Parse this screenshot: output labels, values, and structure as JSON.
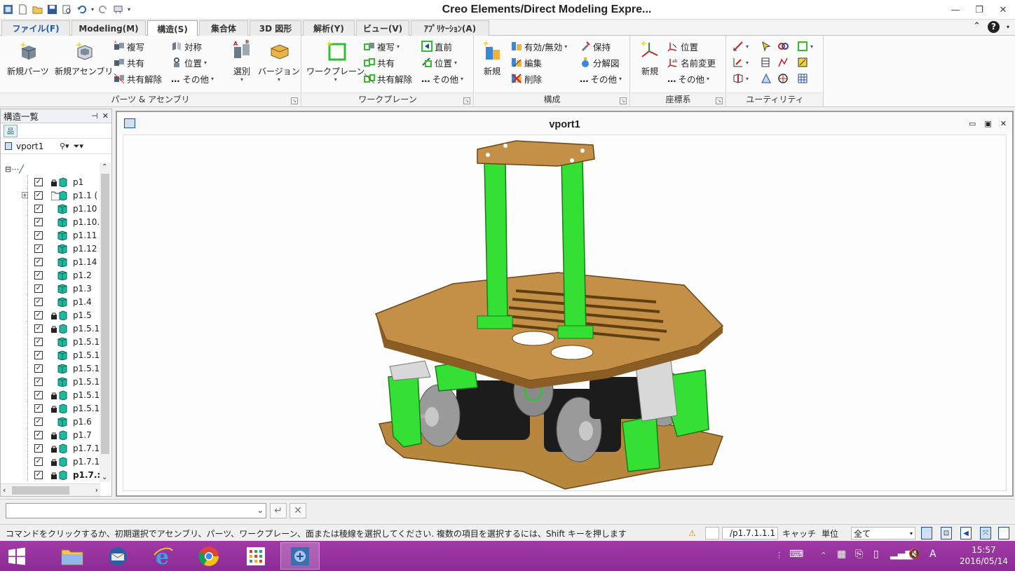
{
  "window": {
    "title": "Creo Elements/Direct Modeling Expre..."
  },
  "quick_access": [
    "app-icon",
    "new-icon",
    "open-icon",
    "save-icon",
    "print-preview-icon",
    "undo-icon",
    "redo-icon",
    "customize-icon"
  ],
  "tabs": [
    {
      "label": "ファイル(F)"
    },
    {
      "label": "Modeling(M)"
    },
    {
      "label": "構造(S)",
      "active": true
    },
    {
      "label": "集合体"
    },
    {
      "label": "3D 図形"
    },
    {
      "label": "解析(Y)"
    },
    {
      "label": "ビュー(V)"
    },
    {
      "label": "ｱﾌﾟﾘｹｰｼｮﾝ(A)"
    }
  ],
  "ribbon": {
    "parts_group": {
      "label": "パーツ & アセンブリ",
      "new_part": "新規パーツ",
      "new_assembly": "新規アセンブリ",
      "copy": "複写",
      "share": "共有",
      "unshare": "共有解除",
      "symmetric": "対称",
      "position": "位置",
      "other": "その他",
      "select": "選別",
      "version": "バージョン"
    },
    "workplane_group": {
      "label": "ワークプレーン",
      "workplane": "ワークプレーン",
      "copy": "複写",
      "share": "共有",
      "unshare": "共有解除",
      "previous": "直前",
      "position": "位置",
      "other": "その他"
    },
    "config_group": {
      "label": "構成",
      "new": "新規",
      "toggle": "有効/無効",
      "edit": "編集",
      "delete": "削除",
      "keep": "保持",
      "explode": "分解図",
      "other": "その他"
    },
    "coord_group": {
      "label": "座標系",
      "new": "新規",
      "position": "位置",
      "rename": "名前変更",
      "other": "その他"
    },
    "utility_group": {
      "label": "ユーティリティ"
    }
  },
  "structure_panel": {
    "title": "構造一覧",
    "viewport_selector": "vport1",
    "items": [
      {
        "name": "p1",
        "type": "assembly"
      },
      {
        "name": "p1.1 (",
        "type": "folder",
        "expandable": true
      },
      {
        "name": "p1.10",
        "type": "part"
      },
      {
        "name": "p1.10.",
        "type": "part"
      },
      {
        "name": "p1.11",
        "type": "part"
      },
      {
        "name": "p1.12",
        "type": "part"
      },
      {
        "name": "p1.14",
        "type": "part"
      },
      {
        "name": "p1.2",
        "type": "part"
      },
      {
        "name": "p1.3",
        "type": "part"
      },
      {
        "name": "p1.4",
        "type": "part"
      },
      {
        "name": "p1.5",
        "type": "assembly"
      },
      {
        "name": "p1.5.1",
        "type": "assembly"
      },
      {
        "name": "p1.5.1",
        "type": "part"
      },
      {
        "name": "p1.5.1",
        "type": "part"
      },
      {
        "name": "p1.5.1",
        "type": "part"
      },
      {
        "name": "p1.5.1",
        "type": "part"
      },
      {
        "name": "p1.5.1",
        "type": "assembly"
      },
      {
        "name": "p1.5.1",
        "type": "assembly"
      },
      {
        "name": "p1.6",
        "type": "part"
      },
      {
        "name": "p1.7",
        "type": "assembly"
      },
      {
        "name": "p1.7.1",
        "type": "assembly"
      },
      {
        "name": "p1.7.1",
        "type": "assembly"
      },
      {
        "name": "p1.7.:",
        "type": "assembly",
        "bold": true
      }
    ]
  },
  "viewport": {
    "title": "vport1"
  },
  "command": {
    "value": ""
  },
  "status": {
    "message": "コマンドをクリックするか、初期選択でアセンブリ、パーツ、ワークプレーン、面または稜線を選択してください. 複数の項目を選択するには、Shift キーを押します",
    "path": "/p1.7.1.1.1",
    "catch_label": "キャッチ",
    "unit_label": "単位",
    "filter": "全て"
  },
  "taskbar": {
    "time": "15:57",
    "date": "2016/05/14",
    "ime": "A"
  },
  "colors": {
    "accent": "#1e5aa8",
    "taskbar": "#9a35a0",
    "green_part": "#33e033",
    "bronze_part": "#b8873e"
  }
}
